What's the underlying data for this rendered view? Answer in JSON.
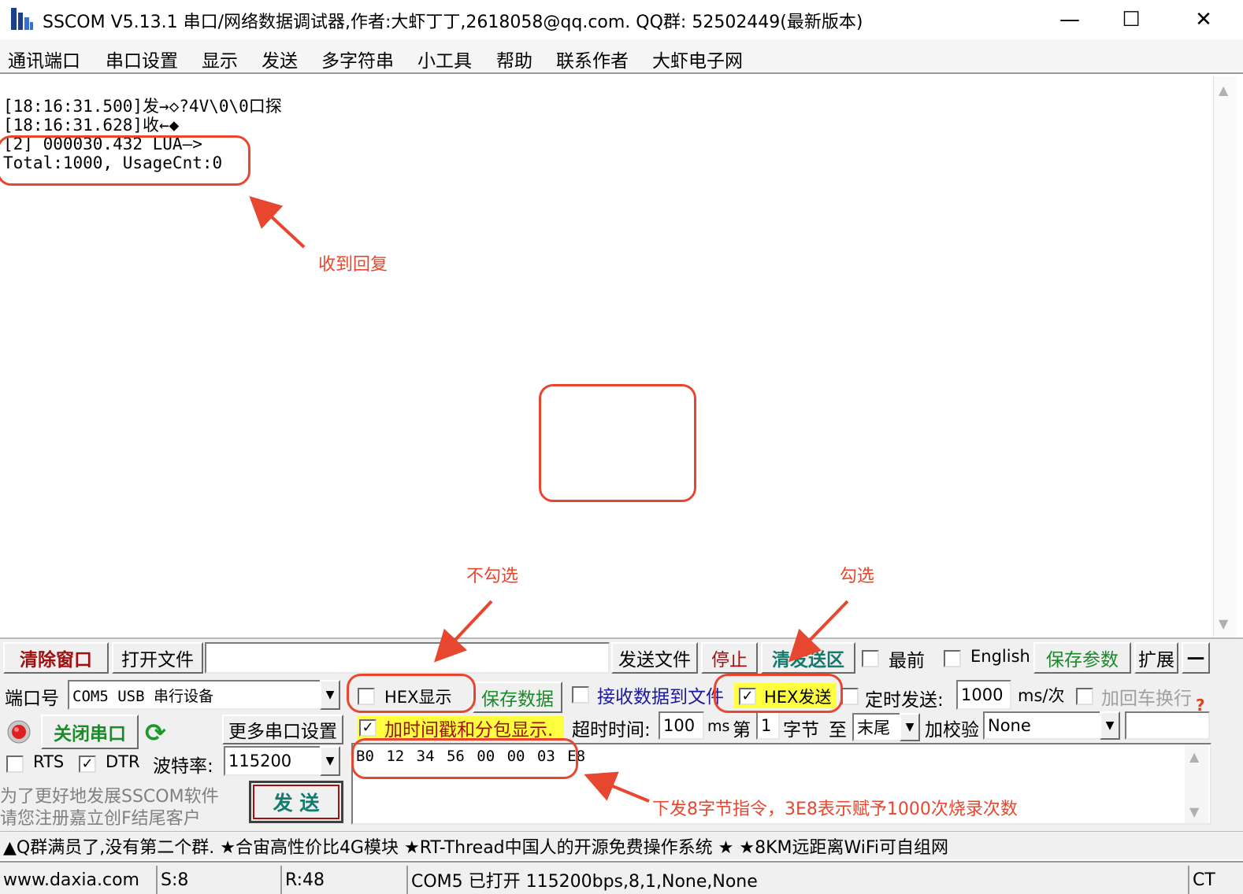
{
  "window": {
    "title": "SSCOM V5.13.1 串口/网络数据调试器,作者:大虾丁丁,2618058@qq.com. QQ群:  52502449(最新版本)",
    "minimize": "—",
    "maximize": "☐",
    "close": "✕"
  },
  "menu": [
    "通讯端口",
    "串口设置",
    "显示",
    "发送",
    "多字符串",
    "小工具",
    "帮助",
    "联系作者",
    "大虾电子网"
  ],
  "receive": {
    "lines": [
      "[18:16:31.500]发→◇?4V\\0\\0口探",
      "[18:16:31.628]收←◆",
      "[2] 000030.432 LUA—>",
      "Total:1000, UsageCnt:0"
    ]
  },
  "annotations": {
    "reply_label": "收到回复",
    "hex_display_label": "不勾选",
    "hex_send_label": "勾选",
    "send_cmd_label": "下发8字节指令，3E8表示赋予1000次烧录次数"
  },
  "toolbar": {
    "clear_window": "清除窗口",
    "open_file": "打开文件",
    "file_path": "",
    "send_file": "发送文件",
    "stop": "停止",
    "clear_send": "清发送区",
    "topmost": "最前",
    "english": "English",
    "save_params": "保存参数",
    "expand": "扩展",
    "collapse": "—"
  },
  "port": {
    "port_label": "端口号",
    "port_value": "COM5 USB 串行设备",
    "close_port": "关闭串口",
    "more_settings": "更多串口设置",
    "rts": "RTS",
    "dtr": "DTR",
    "baud_label": "波特率:",
    "baud_value": "115200",
    "promo_line1": "为了更好地发展SSCOM软件",
    "promo_line2": "请您注册嘉立创F结尾客户",
    "send": "发  送"
  },
  "options": {
    "hex_display": "HEX显示",
    "save_data": "保存数据",
    "receive_to_file": "接收数据到文件",
    "hex_send": "HEX发送",
    "timed_send": "定时发送:",
    "interval_value": "1000",
    "interval_unit": "ms/次",
    "add_crlf": "加回车换行",
    "timestamp": "加时间戳和分包显示.",
    "timeout_label": "超时时间:",
    "timeout_value": "100",
    "timeout_unit": "ms",
    "di": "第",
    "byte_from": "1",
    "byte_unit": "字节",
    "to": "至",
    "byte_to": "末尾",
    "checksum_label": "加校验",
    "checksum_value": "None",
    "help": "?"
  },
  "send_area": {
    "content": "B0 12 34 56 00 00 03 E8"
  },
  "marquee": "▲Q群满员了,没有第二个群. ★合宙高性价比4G模块 ★RT-Thread中国人的开源免费操作系统 ★ ★8KM远距离WiFi可自组网",
  "status": {
    "website": "www.daxia.com",
    "sent": "S:8",
    "received": "R:48",
    "port_state": "COM5 已打开  115200bps,8,1,None,None",
    "cts": "CT"
  },
  "colors": {
    "annotation": "#e8472f",
    "button_red": "#a01010",
    "button_green": "#1a8a2a",
    "button_teal": "#157a6e",
    "highlight_yellow": "#ffff40",
    "link_blue": "#1a1a9a"
  }
}
